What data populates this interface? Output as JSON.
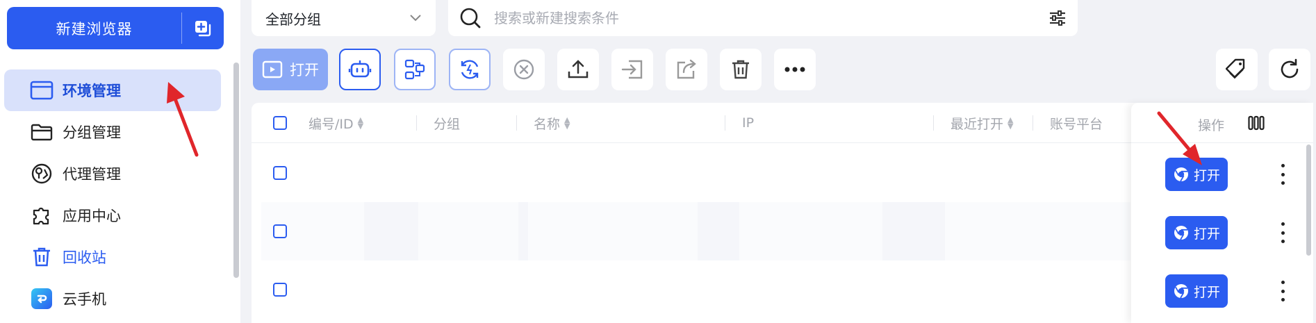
{
  "sidebar": {
    "new_browser_label": "新建浏览器",
    "items": [
      {
        "label": "环境管理",
        "icon": "browser-window-icon",
        "active": true
      },
      {
        "label": "分组管理",
        "icon": "folder-icon"
      },
      {
        "label": "代理管理",
        "icon": "proxy-globe-icon"
      },
      {
        "label": "应用中心",
        "icon": "puzzle-icon"
      },
      {
        "label": "回收站",
        "icon": "trash-icon"
      },
      {
        "label": "云手机",
        "icon": "cloud-phone-icon"
      }
    ]
  },
  "topbar": {
    "group_select_value": "全部分组",
    "search_placeholder": "搜索或新建搜索条件"
  },
  "toolbar": {
    "open_label": "打开"
  },
  "table": {
    "columns": [
      "编号/ID",
      "分组",
      "名称",
      "IP",
      "最近打开",
      "账号平台",
      "操作"
    ],
    "rows": [
      {
        "action_label": "打开"
      },
      {
        "action_label": "打开"
      },
      {
        "action_label": "打开"
      }
    ]
  },
  "colors": {
    "accent": "#2b5cf0",
    "active_bg": "#d9e1fb",
    "annotation_arrow": "#e0262b"
  }
}
